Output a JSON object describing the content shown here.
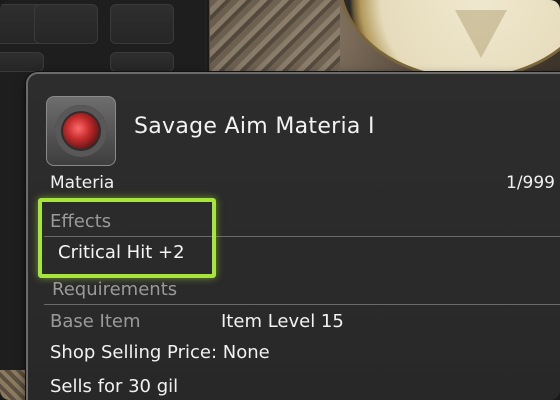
{
  "item": {
    "name": "Savage Aim Materia I",
    "category": "Materia",
    "stack": "1/999",
    "icon": "materia-orb-icon"
  },
  "effects": {
    "label": "Effects",
    "value": "Critical Hit +2"
  },
  "requirements": {
    "label": "Requirements"
  },
  "base_item": {
    "label": "Base Item",
    "value": "Item Level 15"
  },
  "shop_selling_price": "Shop Selling Price: None",
  "sells_for": "Sells for 30 gil",
  "colors": {
    "highlight": "#a6e63a",
    "tooltip_bg": "#2d2d2d",
    "muted_label": "#9a9a9a"
  }
}
